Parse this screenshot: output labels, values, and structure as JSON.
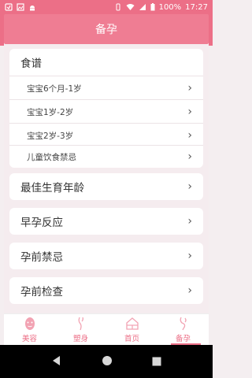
{
  "status_bar": {
    "battery": "100%",
    "time": "17:27"
  },
  "header": {
    "title": "备孕"
  },
  "group": {
    "title": "食谱",
    "items": [
      {
        "label": "宝宝6个月-1岁"
      },
      {
        "label": "宝宝1岁-2岁"
      },
      {
        "label": "宝宝2岁-3岁"
      },
      {
        "label": "儿童饮食禁忌"
      }
    ]
  },
  "rows": [
    {
      "label": "最佳生育年龄"
    },
    {
      "label": "早孕反应"
    },
    {
      "label": "孕前禁忌"
    },
    {
      "label": "孕前检查"
    }
  ],
  "tabs": [
    {
      "label": "美容",
      "icon": "face-mask-icon"
    },
    {
      "label": "塑身",
      "icon": "body-shape-icon"
    },
    {
      "label": "首页",
      "icon": "home-icon"
    },
    {
      "label": "备孕",
      "icon": "pregnancy-icon"
    }
  ],
  "colors": {
    "accent": "#ec6f87",
    "background": "#f5ecef"
  }
}
